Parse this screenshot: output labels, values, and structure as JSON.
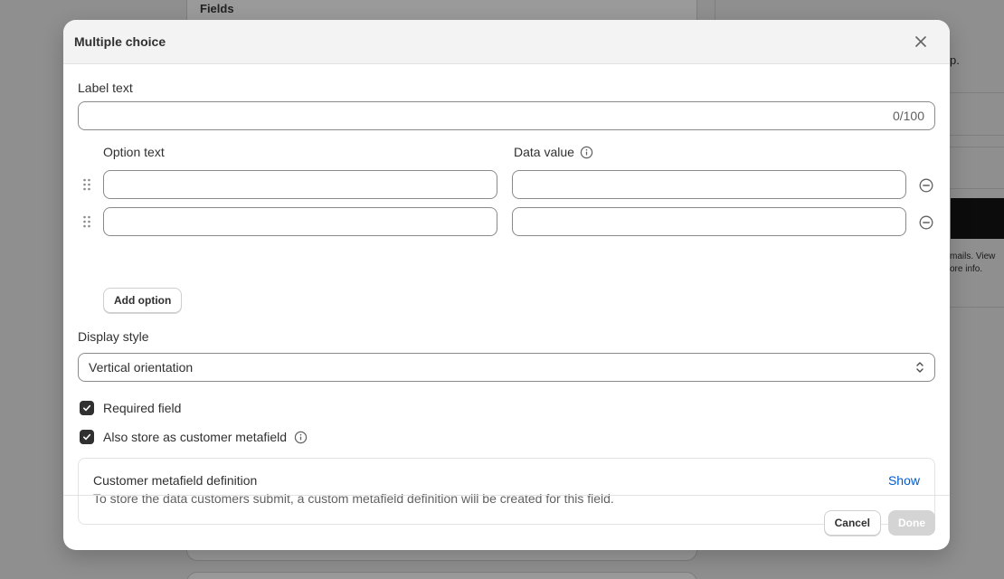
{
  "background": {
    "fields_heading": "Fields",
    "right_panel_text_1": "p.",
    "right_panel_text_2": "mails. View",
    "right_panel_text_3": "ore info."
  },
  "modal": {
    "title": "Multiple choice",
    "label_text": {
      "label": "Label text",
      "value": "",
      "counter": "0/100"
    },
    "options": {
      "option_text_header": "Option text",
      "data_value_header": "Data value",
      "rows": [
        {
          "option_text": "",
          "data_value": ""
        },
        {
          "option_text": "",
          "data_value": ""
        }
      ],
      "add_option_label": "Add option"
    },
    "display_style": {
      "label": "Display style",
      "selected": "Vertical orientation"
    },
    "required_field": {
      "label": "Required field",
      "checked": true
    },
    "store_metafield": {
      "label": "Also store as customer metafield",
      "checked": true
    },
    "metafield_definition": {
      "title": "Customer metafield definition",
      "description": "To store the data customers submit, a custom metafield definition will be created for this field.",
      "show_label": "Show"
    },
    "footer": {
      "cancel_label": "Cancel",
      "done_label": "Done"
    }
  },
  "colors": {
    "link": "#005bd3",
    "checkbox": "#303030",
    "done_disabled": "#d4d4d4"
  }
}
